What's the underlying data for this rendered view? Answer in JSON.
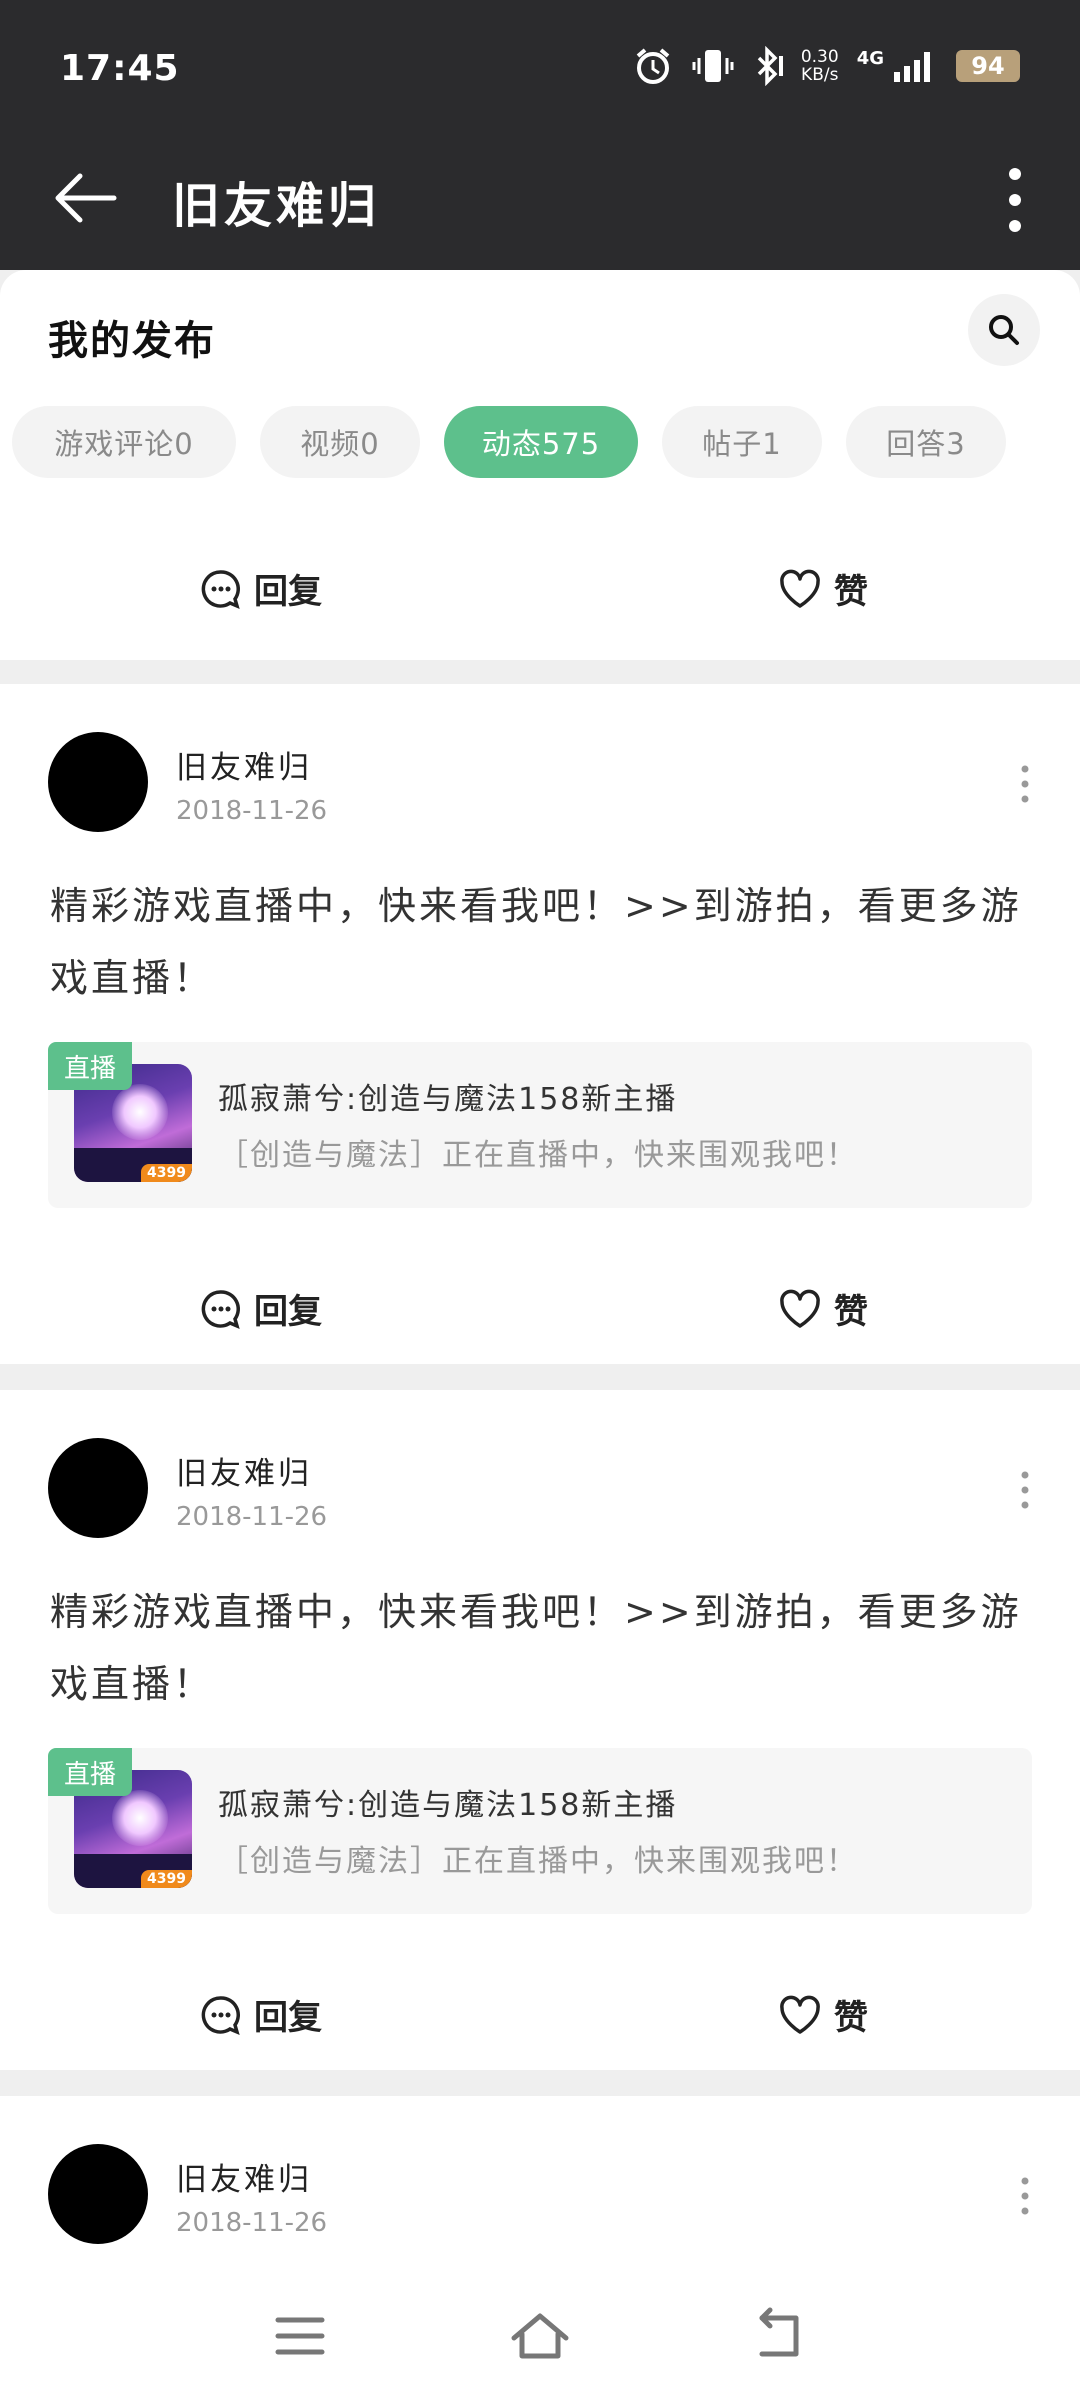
{
  "status_bar": {
    "time": "17:45",
    "net_speed_value": "0.30",
    "net_speed_unit": "KB/s",
    "net_type": "4G",
    "battery": "94",
    "icons": [
      "alarm-icon",
      "vibrate-icon",
      "bluetooth-icon",
      "signal-icon",
      "battery-icon"
    ]
  },
  "app_bar": {
    "title": "旧友难归"
  },
  "panel": {
    "section_title": "我的发布",
    "tabs": [
      {
        "label": "游戏评论0",
        "active": false
      },
      {
        "label": "视频0",
        "active": false
      },
      {
        "label": "动态575",
        "active": true
      },
      {
        "label": "帖子1",
        "active": false
      },
      {
        "label": "回答3",
        "active": false
      }
    ]
  },
  "actions": {
    "reply": "回复",
    "like": "赞"
  },
  "posts": [
    {
      "username": "旧友难归",
      "date": "2018-11-26",
      "content": "精彩游戏直播中，快来看我吧！>>到游拍，看更多游戏直播！",
      "live_badge": "直播",
      "live_title": "孤寂萧兮:创造与魔法158新主播",
      "live_desc": "［创造与魔法］正在直播中，快来围观我吧！",
      "thumb_logo": "4399"
    },
    {
      "username": "旧友难归",
      "date": "2018-11-26",
      "content": "精彩游戏直播中，快来看我吧！>>到游拍，看更多游戏直播！",
      "live_badge": "直播",
      "live_title": "孤寂萧兮:创造与魔法158新主播",
      "live_desc": "［创造与魔法］正在直播中，快来围观我吧！",
      "thumb_logo": "4399"
    },
    {
      "username": "旧友难归",
      "date": "2018-11-26"
    }
  ],
  "colors": {
    "accent": "#5dc08c",
    "bar_bg": "#2b2b2d"
  }
}
